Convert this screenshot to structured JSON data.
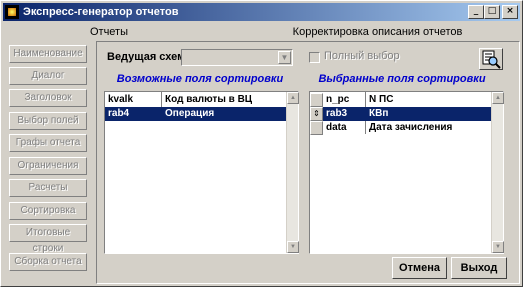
{
  "window": {
    "title": "Экспресс-генератор отчетов",
    "controls": {
      "minimize": "_",
      "maximize": "□",
      "close": "×"
    }
  },
  "tabs": [
    {
      "label": "Отчеты"
    },
    {
      "label": "Корректировка описания отчетов"
    }
  ],
  "sidebar": {
    "items": [
      {
        "label": "Наименование"
      },
      {
        "label": "Диалог"
      },
      {
        "label": "Заголовок"
      },
      {
        "label": "Выбор полей"
      },
      {
        "label": "Графы отчета"
      },
      {
        "label": "Ограничения"
      },
      {
        "label": "Расчеты"
      },
      {
        "label": "Сортировка"
      },
      {
        "label": "Итоговые строки"
      },
      {
        "label": "Сборка отчета"
      }
    ]
  },
  "main": {
    "schema_label": "Ведущая схема :",
    "schema_value": "",
    "full_select_label": "Полный выбор",
    "full_select_checked": false,
    "available": {
      "heading": "Возможные поля сортировки",
      "rows": [
        {
          "code": "kvalk",
          "name": "Код валюты в ВЦ",
          "selected": false
        },
        {
          "code": "rab4",
          "name": "Операция",
          "selected": true
        }
      ]
    },
    "chosen": {
      "heading": "Выбранные поля сортировки",
      "rows": [
        {
          "marker": "",
          "code": "n_pc",
          "name": "N ПС",
          "selected": false
        },
        {
          "marker": "⇕",
          "code": "rab3",
          "name": "КВп",
          "selected": true
        },
        {
          "marker": "",
          "code": "data",
          "name": "Дата зачисления",
          "selected": false
        }
      ]
    },
    "buttons": {
      "cancel": "Отмена",
      "exit": "Выход"
    }
  },
  "icons": {
    "preview": "magnifier-document-icon"
  },
  "colors": {
    "title_start": "#0a246a",
    "title_end": "#a6caf0",
    "heading": "#0000cc",
    "selection": "#0a246a"
  }
}
